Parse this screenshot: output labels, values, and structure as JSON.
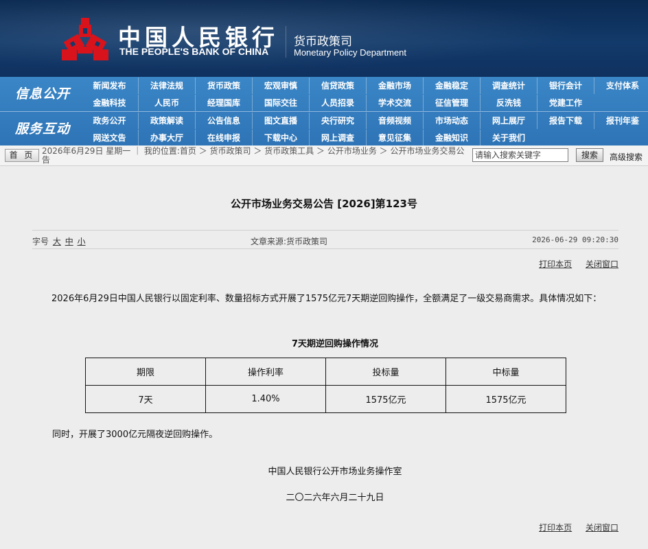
{
  "header": {
    "bank_name_cn": "中国人民银行",
    "bank_name_en": "THE PEOPLE'S BANK OF CHINA",
    "dept_cn": "货币政策司",
    "dept_en": "Monetary Policy Department"
  },
  "nav": {
    "sections": [
      {
        "title": "信息公开",
        "rows": [
          [
            "新闻发布",
            "法律法规",
            "货币政策",
            "宏观审慎",
            "信贷政策",
            "金融市场",
            "金融稳定",
            "调查统计",
            "银行会计",
            "支付体系"
          ],
          [
            "金融科技",
            "人民币",
            "经理国库",
            "国际交往",
            "人员招录",
            "学术交流",
            "征信管理",
            "反洗钱",
            "党建工作"
          ]
        ]
      },
      {
        "title": "服务互动",
        "rows": [
          [
            "政务公开",
            "政策解读",
            "公告信息",
            "图文直播",
            "央行研究",
            "音频视频",
            "市场动态",
            "网上展厅",
            "报告下载",
            "报刊年鉴"
          ],
          [
            "网送文告",
            "办事大厅",
            "在线申报",
            "下载中心",
            "网上调查",
            "意见征集",
            "金融知识",
            "关于我们"
          ]
        ]
      }
    ]
  },
  "breadcrumb": {
    "home_label": "首 页",
    "text": "2026年6月29日 星期一 ｜ 我的位置:首页 ＞ 货币政策司 ＞ 货币政策工具 ＞ 公开市场业务 ＞ 公开市场业务交易公告",
    "search_placeholder": "请输入搜索关键字",
    "search_button": "搜索",
    "advanced_search": "高级搜索"
  },
  "article": {
    "title": "公开市场业务交易公告 [2026]第123号",
    "font_size_label": "字号",
    "font_sizes": [
      "大",
      "中",
      "小"
    ],
    "source": "文章来源:货币政策司",
    "datetime": "2026-06-29 09:20:30",
    "print_label": "打印本页",
    "close_label": "关闭窗口",
    "paragraph1": "2026年6月29日中国人民银行以固定利率、数量招标方式开展了1575亿元7天期逆回购操作，全额满足了一级交易商需求。具体情况如下：",
    "table_title": "7天期逆回购操作情况",
    "table": {
      "headers": [
        "期限",
        "操作利率",
        "投标量",
        "中标量"
      ],
      "row": [
        "7天",
        "1.40%",
        "1575亿元",
        "1575亿元"
      ]
    },
    "paragraph2": "同时，开展了3000亿元隔夜逆回购操作。",
    "signature_org": "中国人民银行公开市场业务操作室",
    "signature_date": "二〇二六年六月二十九日"
  },
  "colors": {
    "header_bg": "#0f3160",
    "nav_bg": "#2e74b6",
    "logo_red": "#d8131b",
    "page_bg": "#ededed"
  }
}
